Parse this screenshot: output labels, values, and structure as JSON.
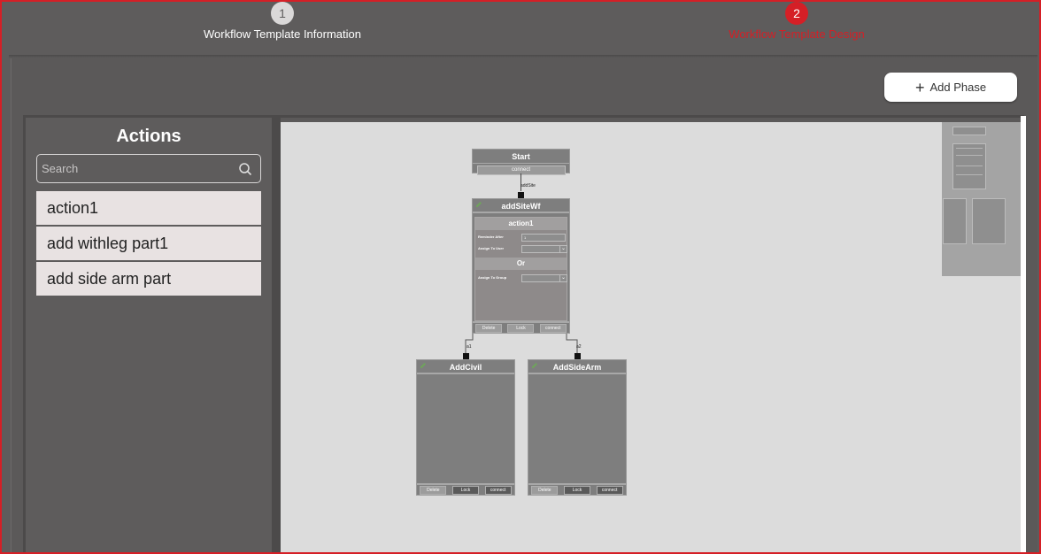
{
  "stepper": {
    "steps": [
      {
        "number": "1",
        "label": "Workflow Template Information",
        "state": "completed"
      },
      {
        "number": "2",
        "label": "Workflow Template Design",
        "state": "active"
      }
    ],
    "active_color": "#d51f26"
  },
  "toolbar": {
    "add_phase_label": "Add Phase",
    "add_phase_icon": "plus-icon"
  },
  "actions_panel": {
    "title": "Actions",
    "search_placeholder": "Search",
    "search_value": "",
    "search_icon": "search-icon",
    "items": [
      "action1",
      "add withleg part1",
      "add side arm part"
    ]
  },
  "canvas": {
    "start_node": {
      "title": "Start",
      "connect_label": "connect"
    },
    "edge_label_start": "addSite",
    "add_site_node": {
      "title": "addSiteWf",
      "card_title": "action1",
      "fields": [
        {
          "label": "Reminder After",
          "value": "1"
        },
        {
          "label": "Assign To User",
          "value": ""
        }
      ],
      "or_label": "Or",
      "group_field": {
        "label": "Assign To Group",
        "value": ""
      },
      "buttons": [
        "Delete",
        "Lock",
        "connect"
      ]
    },
    "edge_label_left": "a1",
    "edge_label_right": "a2",
    "child_nodes": [
      {
        "title": "AddCivil",
        "buttons": [
          "Delete",
          "Lock",
          "connect"
        ]
      },
      {
        "title": "AddSideArm",
        "buttons": [
          "Delete",
          "Lock",
          "connect"
        ]
      }
    ]
  },
  "colors": {
    "background": "#5e5c5c",
    "canvas": "#dcdcdc",
    "node": "#7e7e7e",
    "accent_red": "#d51f26"
  }
}
